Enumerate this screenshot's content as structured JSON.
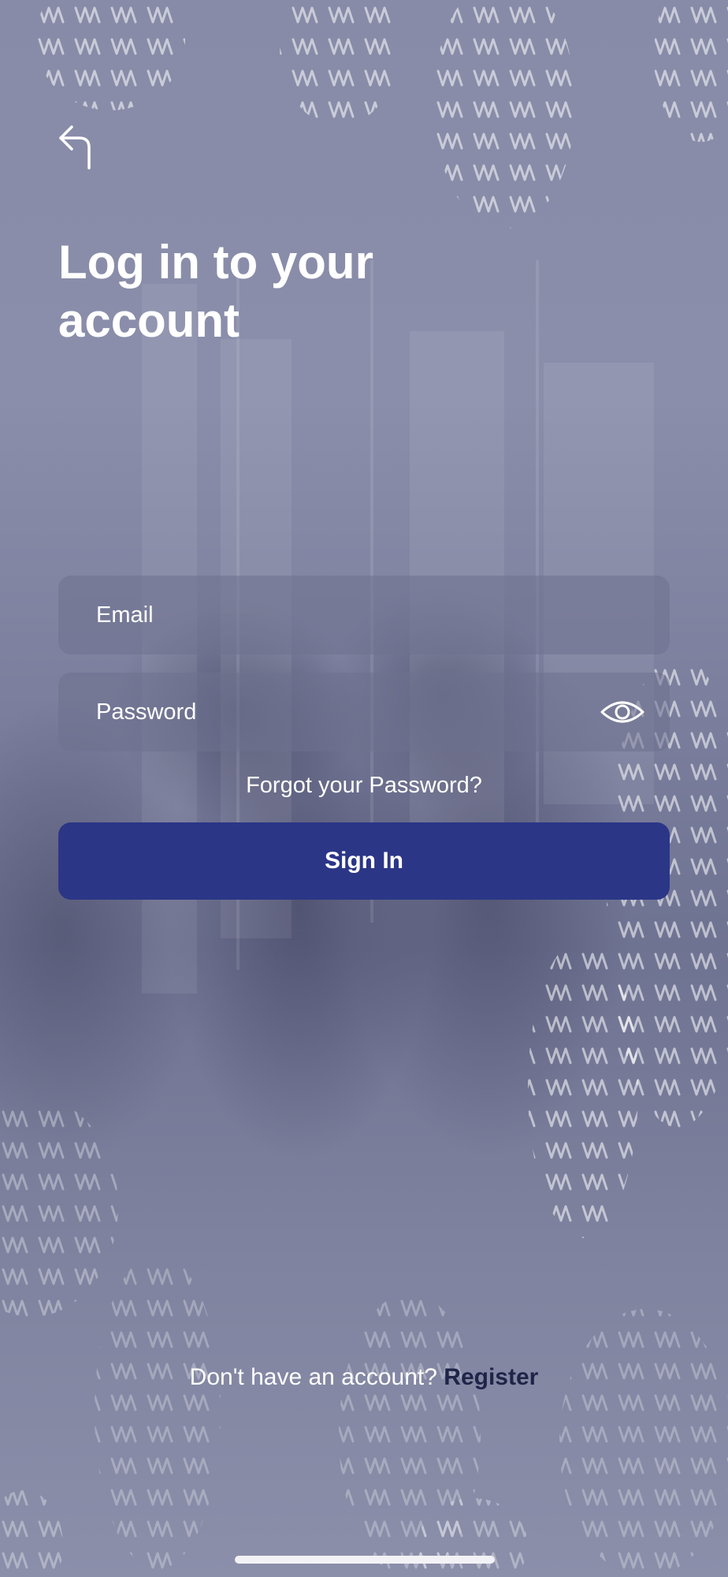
{
  "header": {
    "back_icon": "back-arrow-icon",
    "title": "Log in to your account"
  },
  "form": {
    "email_placeholder": "Email",
    "password_placeholder": "Password",
    "password_toggle_icon": "eye-icon",
    "forgot_label": "Forgot your Password?",
    "signin_label": "Sign In"
  },
  "footer": {
    "prompt": "Don't have an account?",
    "register_label": "Register"
  },
  "colors": {
    "primary_button": "#2b3687",
    "register_link": "#1f2449",
    "text": "#ffffff"
  }
}
